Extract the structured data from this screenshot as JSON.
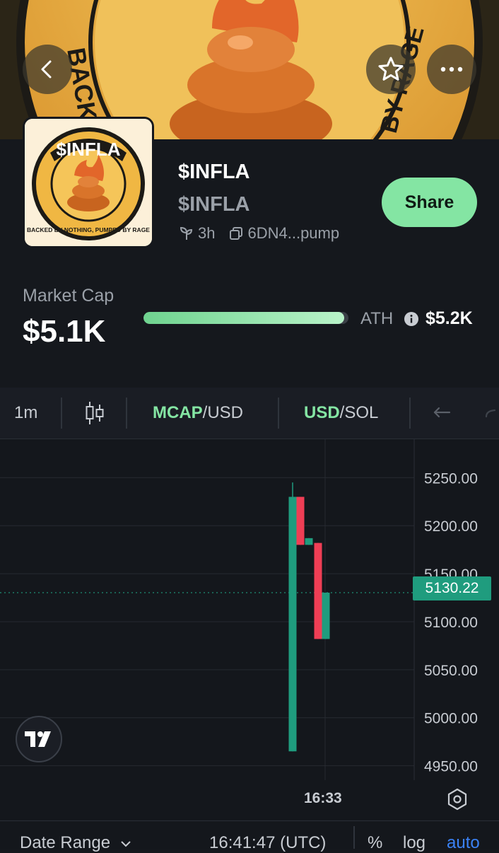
{
  "banner": {
    "text_left": "BACKED",
    "text_right": "BY RAGE",
    "back_icon": "chevron-left-icon",
    "favorite_icon": "star-icon",
    "more_icon": "more-horizontal-icon"
  },
  "token": {
    "logo_title": "$INFLA",
    "logo_subtitle": "BACKED BY NOTHING, PUMPED BY RAGE",
    "name": "$INFLA",
    "symbol": "$INFLA",
    "age": "3h",
    "address": "6DN4...pump",
    "share_label": "Share"
  },
  "market": {
    "label": "Market Cap",
    "value": "$5.1K",
    "progress_fraction": 0.98,
    "ath_label": "ATH",
    "ath_value": "$5.2K"
  },
  "toolbar": {
    "interval": "1m",
    "mcap_left": "MCAP",
    "mcap_right": "/USD",
    "usd_left": "USD",
    "usd_right": "/SOL"
  },
  "chart_data": {
    "type": "candlestick",
    "y_ticks": [
      "5250.00",
      "5200.00",
      "5150.00",
      "5100.00",
      "5050.00",
      "5000.00",
      "4950.00"
    ],
    "ylim": [
      4935,
      5290
    ],
    "current_price": "5130.22",
    "x_tick": "16:33",
    "candles": [
      {
        "open": 4965,
        "close": 5230,
        "high": 5245,
        "low": 4965,
        "direction": "up"
      },
      {
        "open": 5230,
        "close": 5180,
        "high": 5230,
        "low": 5180,
        "direction": "down"
      },
      {
        "open": 5180,
        "close": 5187,
        "high": 5187,
        "low": 5180,
        "direction": "up"
      },
      {
        "open": 5182,
        "close": 5082,
        "high": 5182,
        "low": 5082,
        "direction": "down"
      },
      {
        "open": 5082,
        "close": 5130.22,
        "high": 5130.22,
        "low": 5082,
        "direction": "up"
      }
    ],
    "up_color": "#1f9c7e",
    "down_color": "#ef3e55"
  },
  "bottom": {
    "date_range": "Date Range",
    "time": "16:41:47 (UTC)",
    "percent": "%",
    "log": "log",
    "auto": "auto"
  },
  "colors": {
    "accent": "#84e5a3",
    "background": "#15181d",
    "muted": "#9aa0a8"
  }
}
